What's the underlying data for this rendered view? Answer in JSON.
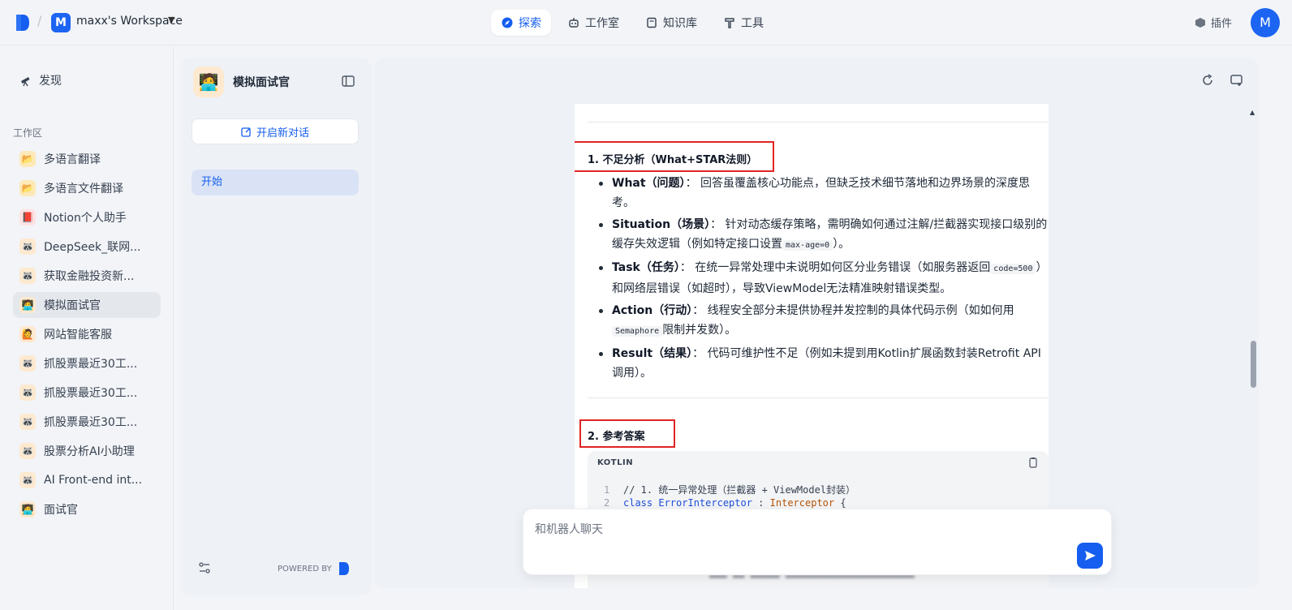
{
  "topbar": {
    "workspace_initial": "M",
    "workspace_name": "maxx's Workspace",
    "nav": [
      {
        "label": "探索",
        "active": true,
        "icon": "compass-icon"
      },
      {
        "label": "工作室",
        "active": false,
        "icon": "robot-icon"
      },
      {
        "label": "知识库",
        "active": false,
        "icon": "book-icon"
      },
      {
        "label": "工具",
        "active": false,
        "icon": "hammer-icon"
      }
    ],
    "plugin_label": "插件",
    "user_initial": "M"
  },
  "sidebar": {
    "discover_label": "发现",
    "section_title": "工作区",
    "apps": [
      {
        "label": "多语言翻译",
        "icon": "folder-icon"
      },
      {
        "label": "多语言文件翻译",
        "icon": "folder-icon"
      },
      {
        "label": "Notion个人助手",
        "icon": "red-book-icon"
      },
      {
        "label": "DeepSeek_联网...",
        "icon": "raccoon-icon"
      },
      {
        "label": "获取金融投资新...",
        "icon": "raccoon-icon"
      },
      {
        "label": "模拟面试官",
        "icon": "interviewer-icon",
        "active": true
      },
      {
        "label": "网站智能客服",
        "icon": "assistant-icon"
      },
      {
        "label": "抓股票最近30工...",
        "icon": "raccoon-icon"
      },
      {
        "label": "抓股票最近30工...",
        "icon": "raccoon-icon"
      },
      {
        "label": "抓股票最近30工...",
        "icon": "raccoon-icon"
      },
      {
        "label": "股票分析AI小助理",
        "icon": "raccoon-icon"
      },
      {
        "label": "AI Front-end int...",
        "icon": "raccoon-icon"
      },
      {
        "label": "面试官",
        "icon": "interviewer-icon"
      }
    ]
  },
  "panel": {
    "bot_name": "模拟面试官",
    "new_chat_label": "开启新对话",
    "conversation": "开始",
    "powered_by": "POWERED BY"
  },
  "message": {
    "heading1": "1. 不足分析（What+STAR法则）",
    "bullets": [
      {
        "term": "What（问题）",
        "sep": "：",
        "text": "回答虽覆盖核心功能点，但缺乏技术细节落地和边界场景的深度思考。"
      },
      {
        "term": "Situation（场景）",
        "sep": "：",
        "text_before": "针对动态缓存策略，需明确如何通过注解/拦截器实现接口级别的缓存失效逻辑（例如特定接口设置",
        "code": "max-age=0",
        "text_after": "）。"
      },
      {
        "term": "Task（任务）",
        "sep": "：",
        "text_before": "在统一异常处理中未说明如何区分业务错误（如服务器返回",
        "code": "code=500",
        "text_after": "）和网络层错误（如超时），导致ViewModel无法精准映射错误类型。"
      },
      {
        "term": "Action（行动）",
        "sep": "：",
        "text_before": "线程安全部分未提供协程并发控制的具体代码示例（如如何用",
        "code": "Semaphore",
        "text_after": "限制并发数）。"
      },
      {
        "term": "Result（结果）",
        "sep": "：",
        "text": "代码可维护性不足（例如未提到用Kotlin扩展函数封装Retrofit API调用）。"
      }
    ],
    "heading2": "2. 参考答案",
    "code_lang": "KOTLIN",
    "code_lines": [
      {
        "num": "1",
        "text": "// 1. 统一异常处理（拦截器 + ViewModel封装）"
      },
      {
        "num": "2",
        "kw": "class",
        "name": "ErrorInterceptor",
        "rest": " : ",
        "type": "Interceptor",
        "tail": " {"
      }
    ]
  },
  "composer": {
    "placeholder": "和机器人聊天"
  }
}
